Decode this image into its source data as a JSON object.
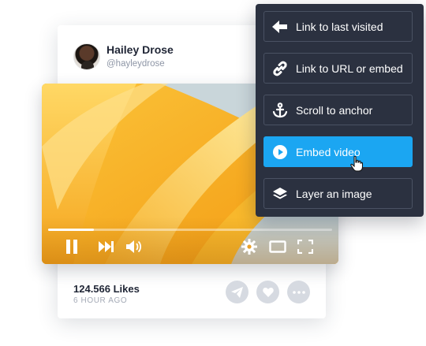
{
  "post": {
    "user_name": "Hailey Drose",
    "user_handle": "@hayleydrose",
    "likes": "124.566 Likes",
    "time": "6 HOUR AGO"
  },
  "video_player": {
    "progress": 0.16,
    "controls": [
      "pause-icon",
      "skip-next-icon",
      "volume-icon",
      "settings-icon",
      "theater-mode-icon",
      "fullscreen-icon"
    ]
  },
  "actions": [
    "send-icon",
    "heart-icon",
    "more-icon"
  ],
  "link_menu": {
    "items": [
      {
        "label": "Link to last visited",
        "icon": "arrow-left-icon",
        "active": false
      },
      {
        "label": "Link to URL or embed",
        "icon": "link-icon",
        "active": false
      },
      {
        "label": "Scroll to anchor",
        "icon": "anchor-icon",
        "active": false
      },
      {
        "label": "Embed video",
        "icon": "play-circle-icon",
        "active": true
      },
      {
        "label": "Layer an image",
        "icon": "layers-icon",
        "active": false
      }
    ]
  },
  "colors": {
    "menu_background": "#2b3140",
    "menu_item_border": "#4a5263",
    "active_item": "#1ba6f2",
    "video_primary": "#f2a51d",
    "text_dark": "#1f2535",
    "text_muted": "#8e96a6",
    "action_button": "#d6dae1"
  }
}
